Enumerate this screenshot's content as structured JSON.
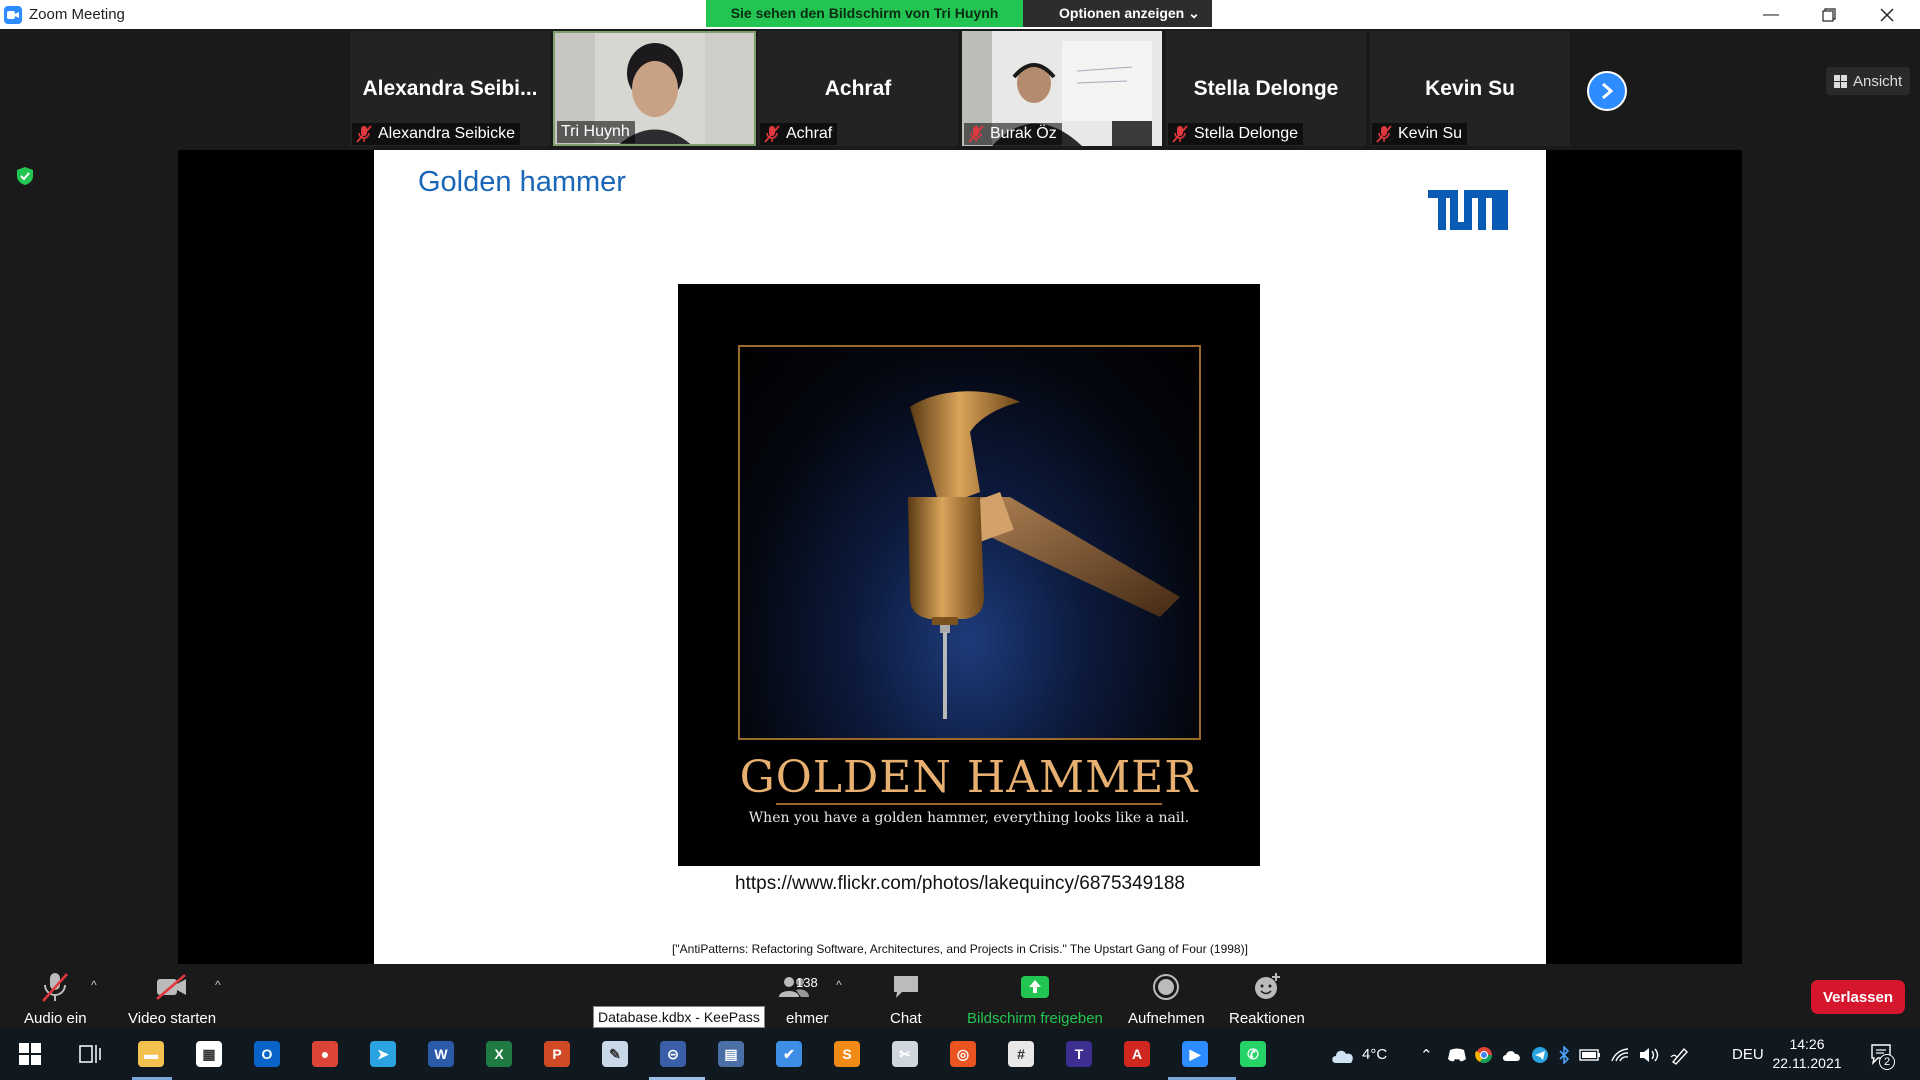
{
  "window": {
    "title": "Zoom Meeting"
  },
  "share_banner": {
    "text": "Sie sehen den Bildschirm von Tri Huynh",
    "options": "Optionen anzeigen"
  },
  "gallery": {
    "view_label": "Ansicht",
    "tiles": [
      {
        "big": "Alexandra  Seibi...",
        "label": "Alexandra Seibicke",
        "muted": true,
        "video": false
      },
      {
        "big": "",
        "label": "Tri Huynh",
        "muted": false,
        "video": true
      },
      {
        "big": "Achraf",
        "label": "Achraf",
        "muted": true,
        "video": false
      },
      {
        "big": "",
        "label": "Burak Öz",
        "muted": true,
        "video": true
      },
      {
        "big": "Stella Delonge",
        "label": "Stella Delonge",
        "muted": true,
        "video": false
      },
      {
        "big": "Kevin Su",
        "label": "Kevin Su",
        "muted": true,
        "video": false
      }
    ]
  },
  "slide": {
    "title": "Golden hammer",
    "logo_text": "TUM",
    "poster_title": "Golden Hammer",
    "poster_tagline": "When you have a golden hammer, everything looks like a nail.",
    "url": "https://www.flickr.com/photos/lakequincy/6875349188",
    "citation": "[\"AntiPatterns: Refactoring Software, Architectures, and Projects in Crisis.\" The Upstart Gang of Four (1998)]"
  },
  "toolbar": {
    "audio": "Audio ein",
    "video": "Video starten",
    "participants_count": "138",
    "participants_partial": "ehmer",
    "chat": "Chat",
    "share": "Bildschirm freigeben",
    "record": "Aufnehmen",
    "reactions": "Reaktionen",
    "leave": "Verlassen"
  },
  "tooltip": "Database.kdbx - KeePass",
  "taskbar": {
    "weather": "4°C",
    "language": "DEU",
    "time": "14:26",
    "date": "22.11.2021",
    "notification_count": "2",
    "icons": [
      {
        "name": "start-icon",
        "color": "#1e90ff"
      },
      {
        "name": "task-view-icon",
        "color": "#cfd6dd"
      },
      {
        "name": "file-explorer-icon",
        "color": "#f2c14e"
      },
      {
        "name": "microsoft-store-icon",
        "color": "#ffffff"
      },
      {
        "name": "outlook-icon",
        "color": "#0a64c8"
      },
      {
        "name": "chrome-icon",
        "color": "#db4437"
      },
      {
        "name": "telegram-icon",
        "color": "#2aa3e0"
      },
      {
        "name": "word-icon",
        "color": "#2b5aa8"
      },
      {
        "name": "excel-icon",
        "color": "#1f7a43"
      },
      {
        "name": "powerpoint-icon",
        "color": "#d04a26"
      },
      {
        "name": "paint-icon",
        "color": "#c9d8e8"
      },
      {
        "name": "keepass-icon",
        "color": "#3a5fa8"
      },
      {
        "name": "calculator-icon",
        "color": "#4a6fa5"
      },
      {
        "name": "todo-icon",
        "color": "#3e8ee6"
      },
      {
        "name": "sublime-text-icon",
        "color": "#f28a16"
      },
      {
        "name": "snipping-tool-icon",
        "color": "#cfd6dd"
      },
      {
        "name": "ubuntu-icon",
        "color": "#e95420"
      },
      {
        "name": "slack-icon",
        "color": "#e8e8e8"
      },
      {
        "name": "texstudio-icon",
        "color": "#3d2f8f"
      },
      {
        "name": "acrobat-icon",
        "color": "#d0281e"
      },
      {
        "name": "zoom-icon",
        "color": "#2d8cff"
      },
      {
        "name": "whatsapp-icon",
        "color": "#25d366"
      }
    ]
  }
}
